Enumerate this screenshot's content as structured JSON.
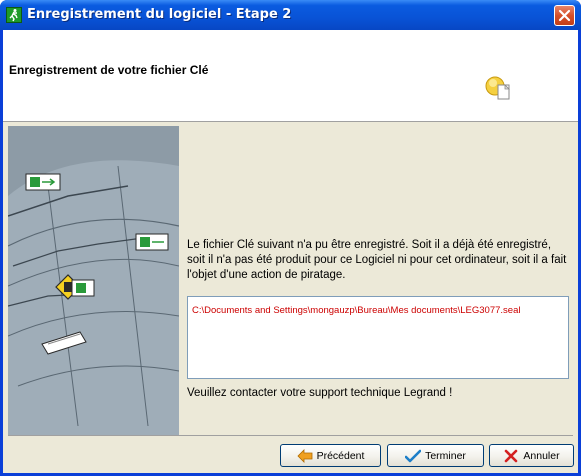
{
  "window": {
    "title": "Enregistrement du logiciel - Etape 2",
    "title_bar_color": "#0953d6"
  },
  "header": {
    "title": "Enregistrement de votre fichier Clé",
    "icon": "key-file-icon"
  },
  "content": {
    "message": "Le fichier Clé suivant n'a pu être enregistré. Soit il a déjà été enregistré, soit il n'a pas été produit pour ce Logiciel ni pour cet ordinateur, soit il a fait l'objet d'une action de piratage.",
    "file_path": "C:\\Documents and Settings\\mongauzp\\Bureau\\Mes documents\\LEG3077.seal",
    "contact_text": "Veuillez contacter votre support technique Legrand !",
    "path_color": "#cc0000"
  },
  "buttons": {
    "previous": "Précédent",
    "finish": "Terminer",
    "cancel": "Annuler"
  },
  "side_image": {
    "icon": "emergency-exit-illustration"
  }
}
